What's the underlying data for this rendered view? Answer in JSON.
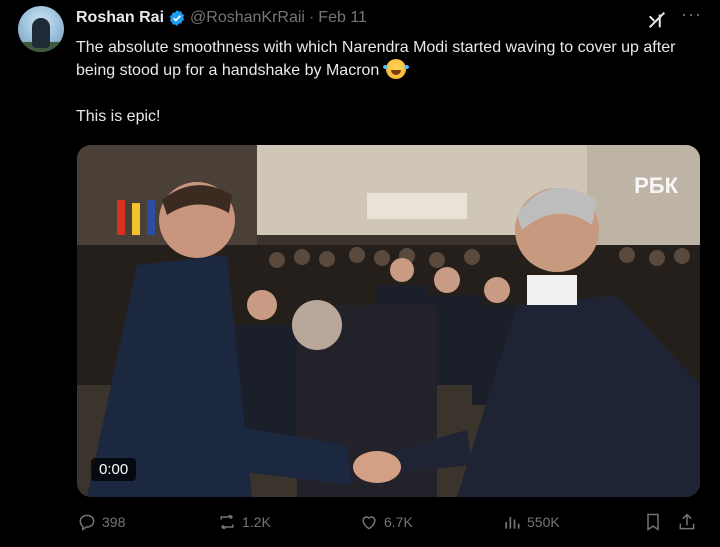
{
  "tweet": {
    "author_name": "Roshan Rai",
    "handle": "@RoshanKrRaii",
    "separator": "·",
    "date": "Feb 11",
    "text_line1": "The absolute smoothness with which Narendra Modi started waving to cover up after being stood up for a handshake by Macron",
    "text_line2": "This is epic!",
    "more_label": "···"
  },
  "media": {
    "watermark": "РБК",
    "timecode": "0:00"
  },
  "actions": {
    "replies": "398",
    "reposts": "1.2K",
    "likes": "6.7K",
    "views": "550K"
  },
  "colors": {
    "background": "#000000",
    "text": "#e7e9ea",
    "secondary": "#71767b",
    "verified": "#1d9bf0"
  }
}
